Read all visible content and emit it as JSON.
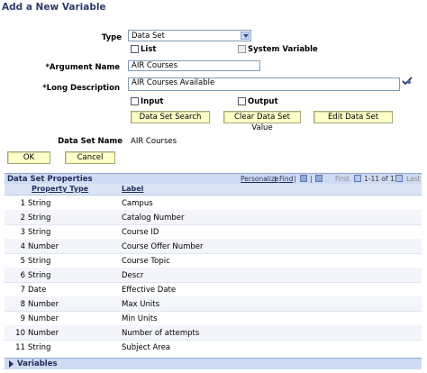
{
  "page_title": "Add a New Variable",
  "form": {
    "type_label": "Type",
    "type_value": "Data Set",
    "list_label": "List",
    "system_variable_label": "System Variable",
    "argument_name_label": "*Argument Name",
    "argument_name_value": "AIR Courses",
    "long_description_label": "*Long Description",
    "long_description_value": "AIR Courses Available",
    "input_label": "Input",
    "output_label": "Output",
    "data_set_search_label": "Data Set Search",
    "clear_data_set_value_label": "Clear Data Set Value",
    "edit_data_set_label": "Edit Data Set",
    "data_set_name_label": "Data Set Name",
    "data_set_name_value": "AIR Courses",
    "ok_label": "OK",
    "cancel_label": "Cancel"
  },
  "grid": {
    "title": "Data Set Properties",
    "personalize_label": "Personalize",
    "find_label": "Find",
    "separator": "|",
    "first_label": "First",
    "range_label": "1-11 of 11",
    "last_label": "Last",
    "columns": [
      "Property Type",
      "Label"
    ],
    "rows": [
      {
        "n": "1",
        "type": "String",
        "label": "Campus"
      },
      {
        "n": "2",
        "type": "String",
        "label": "Catalog Number"
      },
      {
        "n": "3",
        "type": "String",
        "label": "Course ID"
      },
      {
        "n": "4",
        "type": "Number",
        "label": "Course Offer Number"
      },
      {
        "n": "5",
        "type": "String",
        "label": "Course Topic"
      },
      {
        "n": "6",
        "type": "String",
        "label": "Descr"
      },
      {
        "n": "7",
        "type": "Date",
        "label": "Effective Date"
      },
      {
        "n": "8",
        "type": "Number",
        "label": "Max Units"
      },
      {
        "n": "9",
        "type": "Number",
        "label": "Min Units"
      },
      {
        "n": "10",
        "type": "Number",
        "label": "Number of attempts"
      },
      {
        "n": "11",
        "type": "String",
        "label": "Subject Area"
      }
    ]
  },
  "variables_label": "Variables"
}
